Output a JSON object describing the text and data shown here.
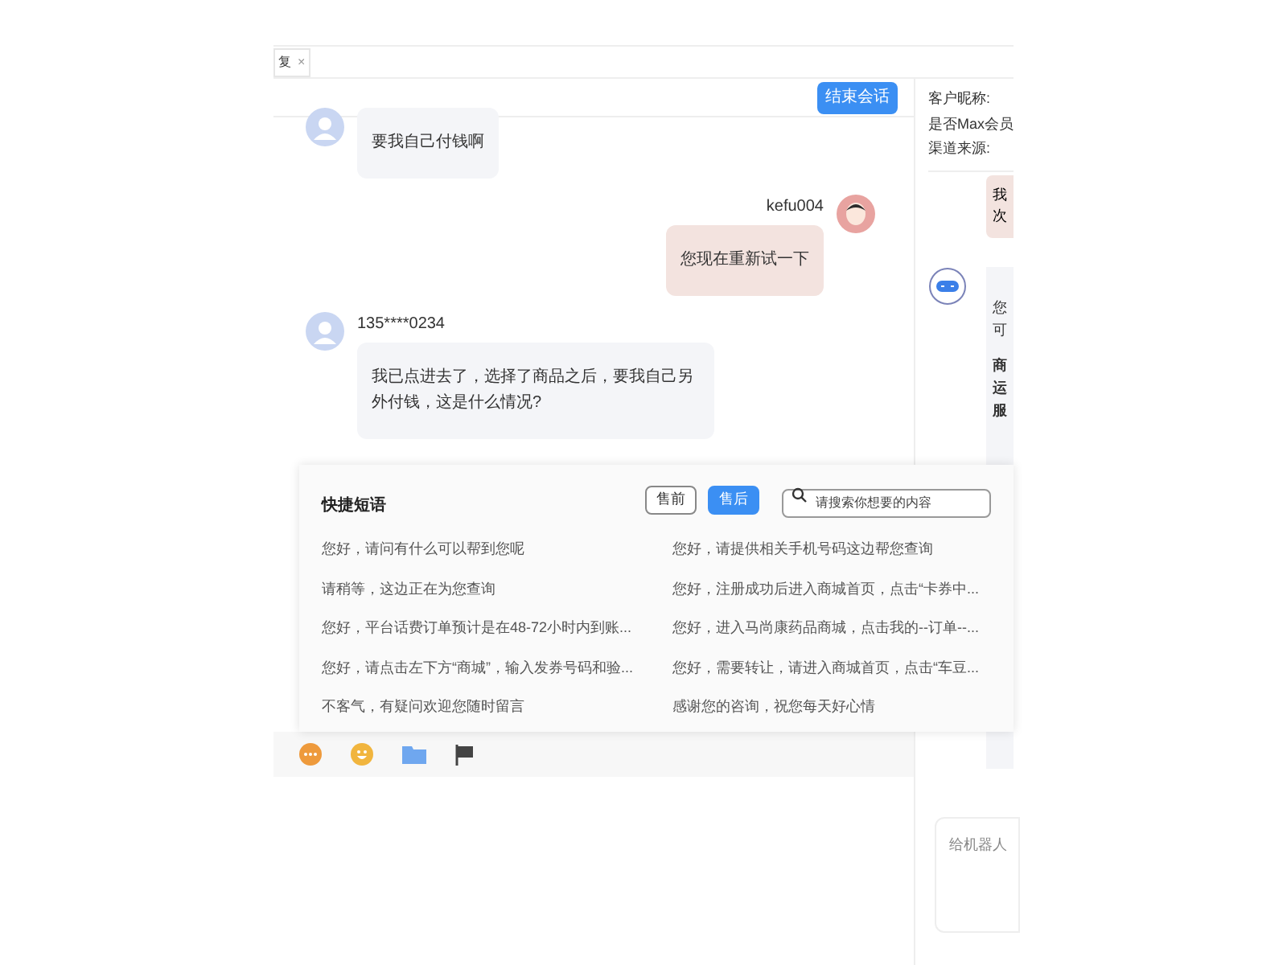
{
  "tab": {
    "label": "复",
    "close": "×"
  },
  "header": {
    "end_button": "结束会话"
  },
  "customer_info": [
    "客户昵称:",
    "是否Max会员",
    "渠道来源:"
  ],
  "messages": [
    {
      "kind": "customer",
      "text": "要我自己付钱啊"
    },
    {
      "kind": "agent",
      "name": "kefu004",
      "text": "您现在重新试一下"
    },
    {
      "kind": "customer",
      "name": "135****0234",
      "text": "我已点进去了，选择了商品之后，要我自己另外付钱，这是什么情况?"
    }
  ],
  "quick_phrases": {
    "title": "快捷短语",
    "tabs": [
      {
        "label": "售前",
        "selected": false
      },
      {
        "label": "售后",
        "selected": true
      }
    ],
    "search": {
      "placeholder": "请搜索你想要的内容"
    },
    "items": [
      "您好，请问有什么可以帮到您呢",
      "您好，请提供相关手机号码这边帮您查询",
      "请稍等，这边正在为您查询",
      "您好，注册成功后进入商城首页，点击“卡券中...",
      "您好，平台话费订单预计是在48-72小时内到账...",
      "您好，进入马尚康药品商城，点击我的--订单--...",
      "您好，请点击左下方“商城”，输入发券号码和验...",
      "您好，需要转让，请进入商城首页，点击“车豆...",
      "不客气，有疑问欢迎您随时留言",
      "感谢您的咨询，祝您每天好心情"
    ]
  },
  "robot_panel": {
    "staff_bubble": [
      "我",
      "次"
    ],
    "robot_bubble": [
      {
        "text": "您",
        "bold": false
      },
      {
        "text": "可",
        "bold": false
      },
      {
        "text": "商",
        "bold": true
      },
      {
        "text": "运",
        "bold": true
      },
      {
        "text": "服",
        "bold": true
      }
    ],
    "input": {
      "placeholder": "给机器人"
    }
  }
}
